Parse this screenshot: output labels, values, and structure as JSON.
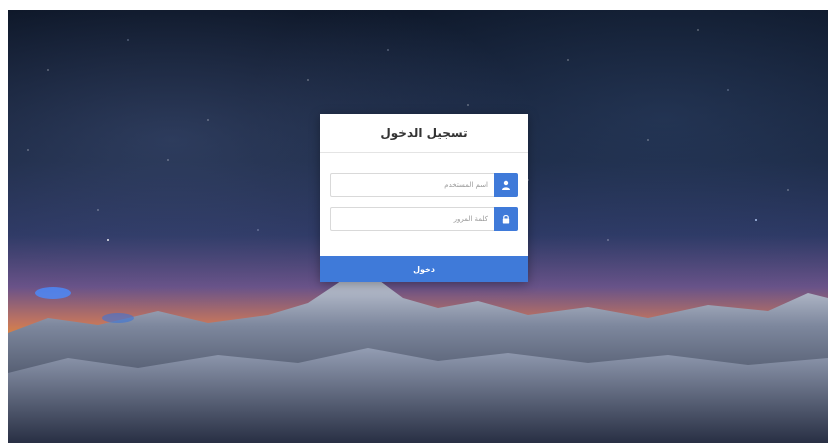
{
  "login": {
    "title": "تسجيل الدخول",
    "username": {
      "placeholder": "اسم المستخدم",
      "value": "",
      "icon": "user-icon"
    },
    "password": {
      "placeholder": "كلمة المرور",
      "value": "",
      "icon": "lock-icon"
    },
    "submit_label": "دخول"
  },
  "colors": {
    "accent": "#3f7ad9",
    "panel_background": "#ffffff",
    "title_text": "#333333"
  }
}
